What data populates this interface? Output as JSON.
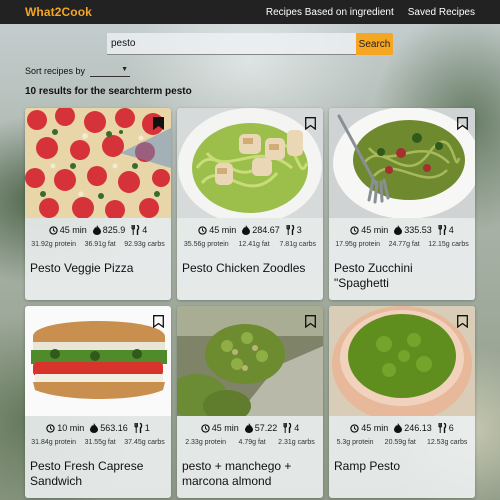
{
  "nav": {
    "brand": "What2Cook",
    "links": [
      "Recipes Based on ingredient",
      "Saved Recipes"
    ]
  },
  "search": {
    "value": "pesto",
    "button_label": "Search"
  },
  "sort": {
    "label": "Sort recipes by",
    "selected": ""
  },
  "results_text": "10 results for the searchterm pesto",
  "recipes": [
    {
      "title": "Pesto Veggie Pizza",
      "time": "45 min",
      "calories": "825.9",
      "servings": "4",
      "protein": "31.92g protein",
      "fat": "36.91g fat",
      "carbs": "92.93g carbs"
    },
    {
      "title": "Pesto Chicken Zoodles",
      "time": "45 min",
      "calories": "284.67",
      "servings": "3",
      "protein": "35.56g protein",
      "fat": "12.41g fat",
      "carbs": "7.81g carbs"
    },
    {
      "title": "Pesto Zucchini \"Spaghetti",
      "time": "45 min",
      "calories": "335.53",
      "servings": "4",
      "protein": "17.95g protein",
      "fat": "24.77g fat",
      "carbs": "12.15g carbs"
    },
    {
      "title": "Pesto Fresh Caprese Sandwich",
      "time": "10 min",
      "calories": "563.16",
      "servings": "1",
      "protein": "31.84g protein",
      "fat": "31.55g fat",
      "carbs": "37.45g carbs"
    },
    {
      "title": "pesto + manchego + marcona almond",
      "time": "45 min",
      "calories": "57.22",
      "servings": "4",
      "protein": "2.33g protein",
      "fat": "4.79g fat",
      "carbs": "2.31g carbs"
    },
    {
      "title": "Ramp Pesto",
      "time": "45 min",
      "calories": "246.13",
      "servings": "6",
      "protein": "5.3g protein",
      "fat": "20.59g fat",
      "carbs": "12.53g carbs"
    }
  ],
  "icons": {
    "time": "clock-icon",
    "calories": "flame-icon",
    "servings": "utensils-icon",
    "save": "bookmark-icon"
  },
  "colors": {
    "accent": "#f5a623",
    "navbar": "#222222"
  }
}
